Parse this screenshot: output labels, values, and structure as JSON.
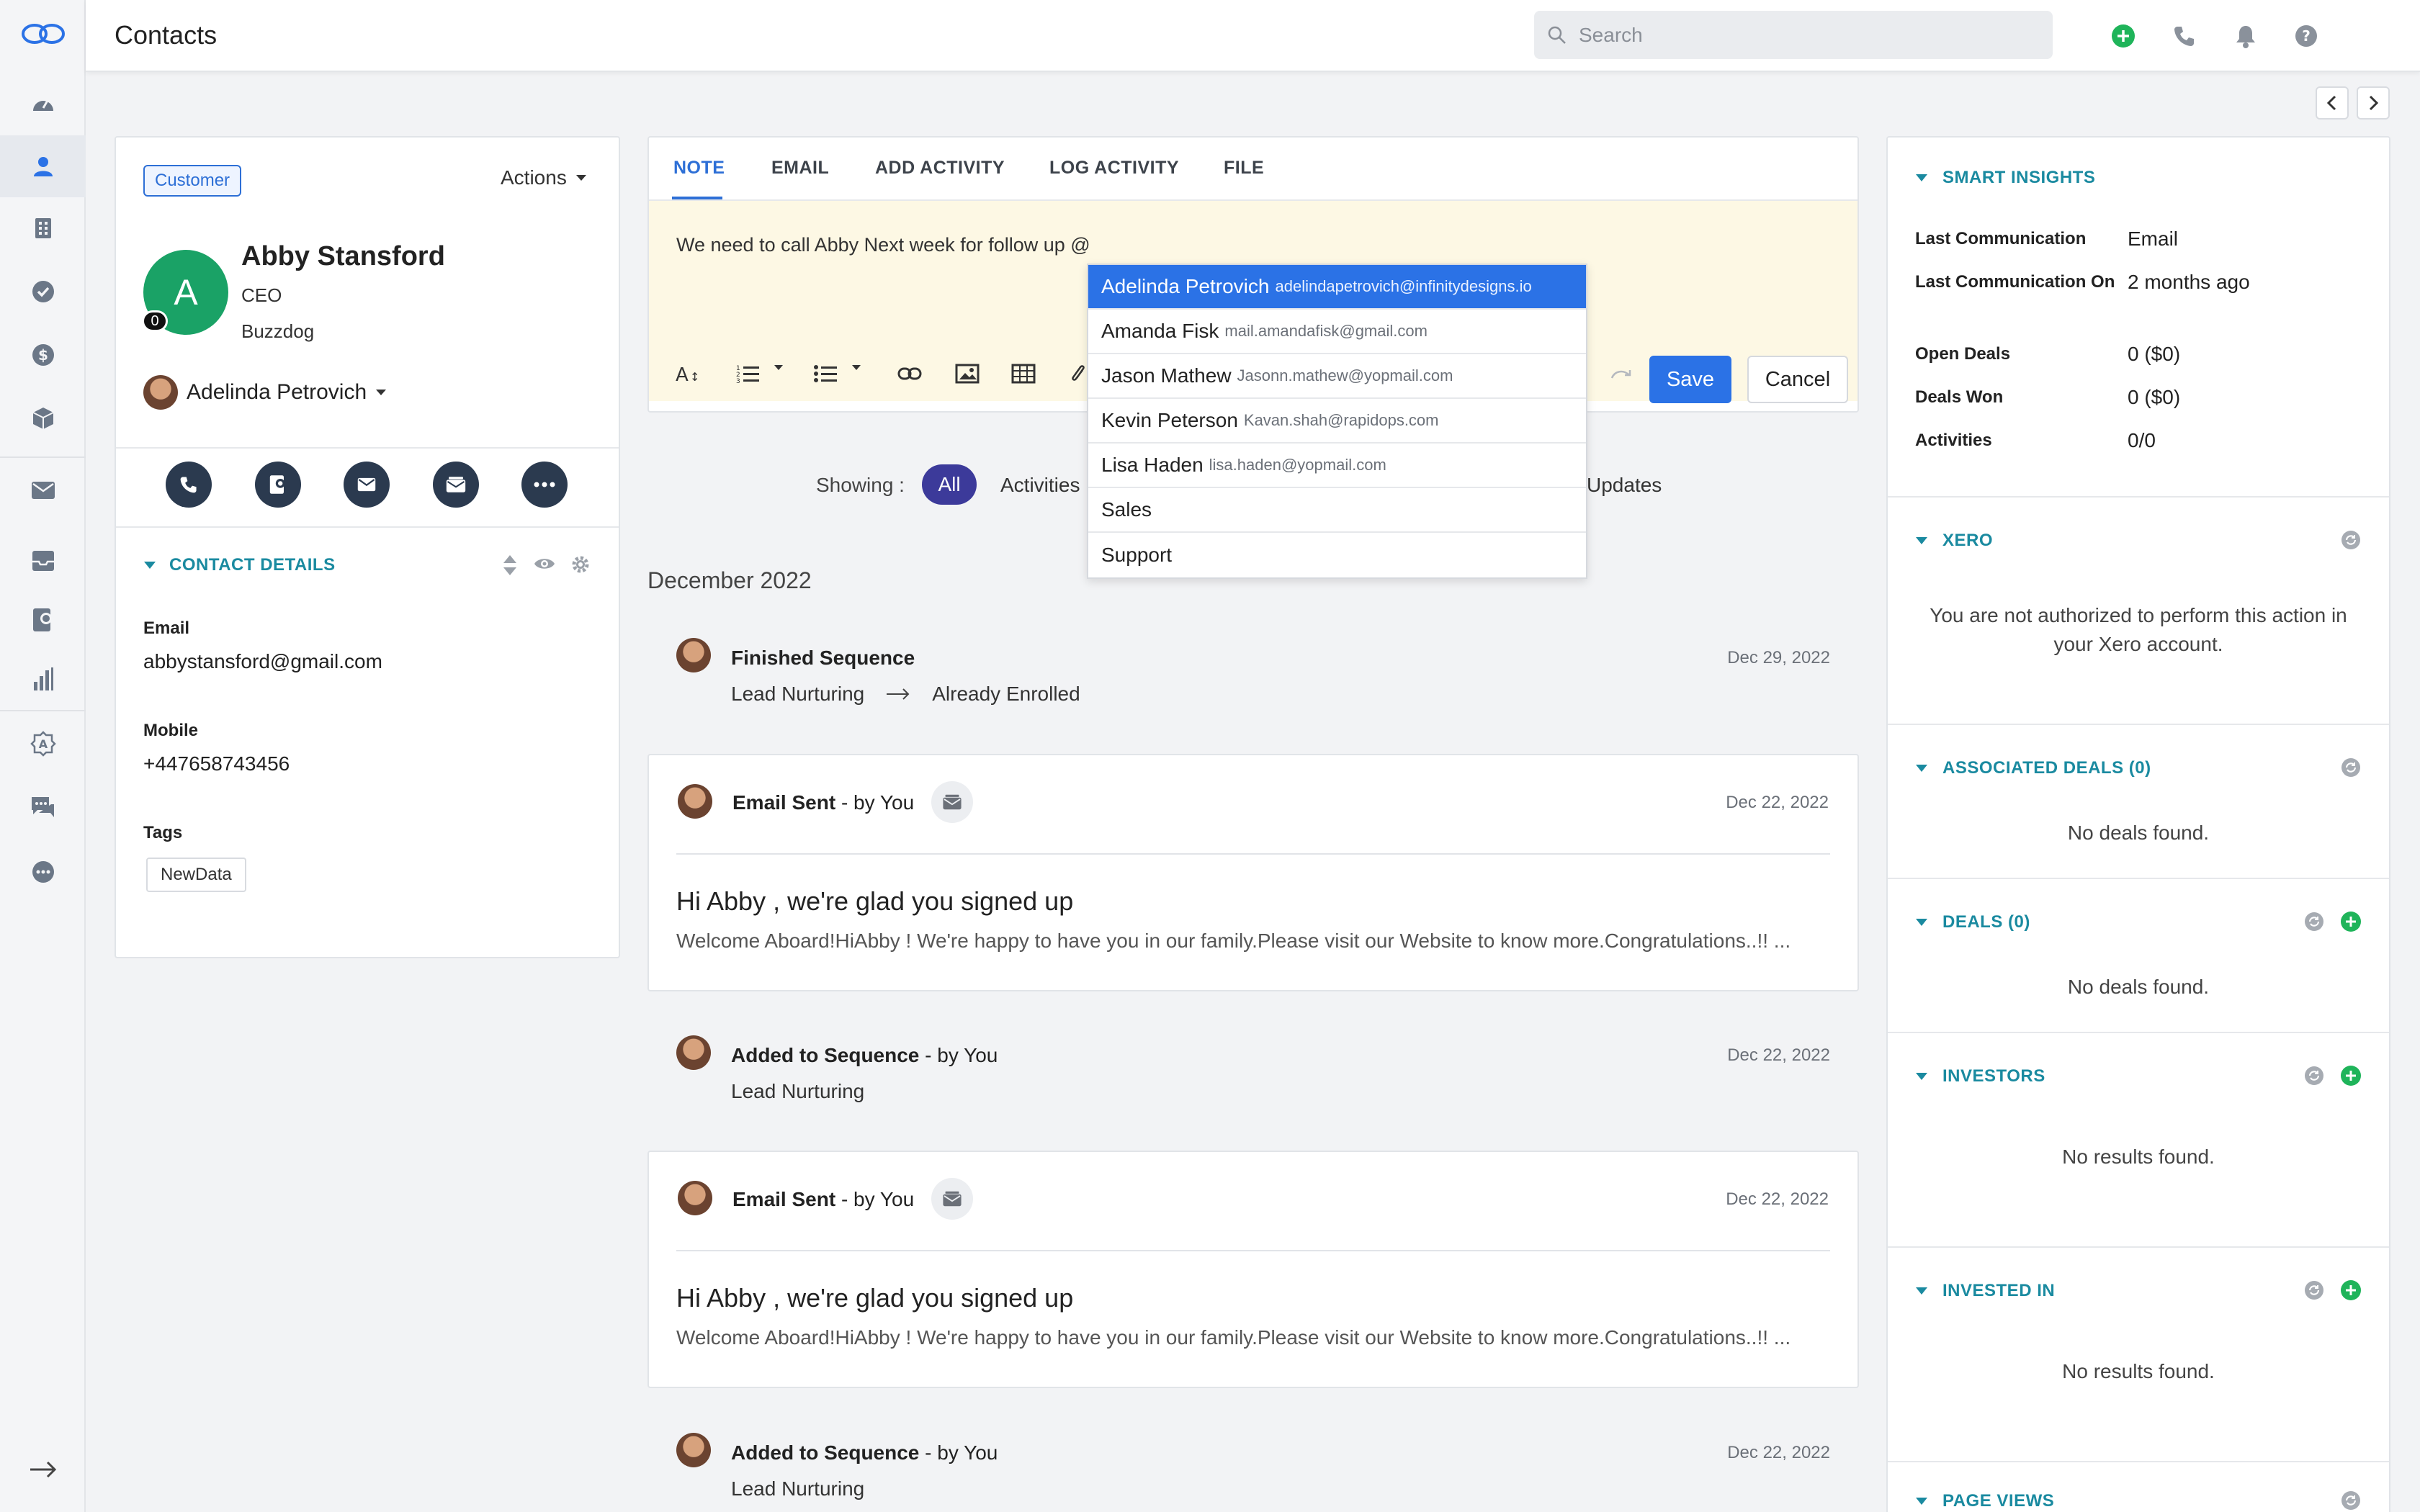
{
  "app": {
    "page_title": "Contacts"
  },
  "search": {
    "placeholder": "Search"
  },
  "nav": {
    "items": [
      "dashboard-icon",
      "contacts-icon",
      "companies-icon",
      "tasks-icon",
      "deals-icon",
      "products-icon",
      "email-icon",
      "inbox-icon",
      "sequences-icon",
      "reports-icon",
      "marketplace-icon",
      "chat-icon",
      "more-icon",
      "collapse-arrow-icon"
    ]
  },
  "contact": {
    "type_badge": "Customer",
    "actions_label": "Actions",
    "avatar_letter": "A",
    "avatar_count": "0",
    "name": "Abby Stansford",
    "role": "CEO",
    "company": "Buzzdog",
    "owner": "Adelinda Petrovich",
    "details_header": "CONTACT DETAILS",
    "email_label": "Email",
    "email": "abbystansford@gmail.com",
    "mobile_label": "Mobile",
    "mobile": "+447658743456",
    "tags_label": "Tags",
    "tag": "NewData"
  },
  "composer": {
    "tabs": [
      "NOTE",
      "EMAIL",
      "ADD ACTIVITY",
      "LOG ACTIVITY",
      "FILE"
    ],
    "active_tab": "NOTE",
    "text": "We need to call Abby Next week for follow up @",
    "save_label": "Save",
    "cancel_label": "Cancel"
  },
  "mention_dropdown": [
    {
      "name": "Adelinda Petrovich",
      "email": "adelindapetrovich@infinitydesigns.io",
      "selected": true
    },
    {
      "name": "Amanda Fisk",
      "email": "mail.amandafisk@gmail.com"
    },
    {
      "name": "Jason Mathew",
      "email": "Jasonn.mathew@yopmail.com"
    },
    {
      "name": "Kevin Peterson",
      "email": "Kavan.shah@rapidops.com"
    },
    {
      "name": "Lisa Haden",
      "email": "lisa.haden@yopmail.com"
    },
    {
      "name": "Sales",
      "email": ""
    },
    {
      "name": "Support",
      "email": ""
    }
  ],
  "filter": {
    "label": "Showing :",
    "options": [
      "All",
      "Activities",
      "Updates"
    ]
  },
  "timeline": {
    "month": "December 2022",
    "items": [
      {
        "title": "Finished Sequence",
        "by": "",
        "from": "Lead Nurturing",
        "to": "Already Enrolled",
        "date": "Dec 29, 2022"
      },
      {
        "title": "Email Sent",
        "by": " - by You",
        "date": "Dec 22, 2022",
        "subject": "Hi Abby , we're glad you signed up",
        "preview": "Welcome Aboard!HiAbby ! We're happy to have you in our family.Please visit our Website to know more.Congratulations..!! ..."
      },
      {
        "title": "Added to Sequence",
        "by": " - by You",
        "sub": "Lead Nurturing",
        "date": "Dec 22, 2022"
      },
      {
        "title": "Email Sent",
        "by": " - by You",
        "date": "Dec 22, 2022",
        "subject": "Hi Abby , we're glad you signed up",
        "preview": "Welcome Aboard!HiAbby ! We're happy to have you in our family.Please visit our Website to know more.Congratulations..!! ..."
      },
      {
        "title": "Added to Sequence",
        "by": " - by You",
        "sub": "Lead Nurturing",
        "date": "Dec 22, 2022"
      }
    ]
  },
  "insights": {
    "header": "SMART INSIGHTS",
    "rows": [
      {
        "label": "Last Communication",
        "value": "Email"
      },
      {
        "label": "Last Communication On",
        "value": "2 months ago"
      },
      {
        "label": "Open Deals",
        "value": "0 ($0)"
      },
      {
        "label": "Deals Won",
        "value": "0 ($0)"
      },
      {
        "label": "Activities",
        "value": "0/0"
      }
    ]
  },
  "panels": {
    "xero": {
      "header": "XERO",
      "message": "You are not authorized to perform this action in your Xero account."
    },
    "associated_deals": {
      "header": "ASSOCIATED DEALS (0)",
      "message": "No deals found."
    },
    "deals": {
      "header": "DEALS (0)",
      "message": "No deals found."
    },
    "investors": {
      "header": "INVESTORS",
      "message": "No results found."
    },
    "invested_in": {
      "header": "INVESTED IN",
      "message": "No results found."
    },
    "page_views": {
      "header": "PAGE VIEWS"
    }
  },
  "colors": {
    "accent": "#2b72e6",
    "teal": "#1a8aa0",
    "nav_dark": "#2b3a4f",
    "filter_pill": "#3c3a9a",
    "green": "#1aa266"
  }
}
